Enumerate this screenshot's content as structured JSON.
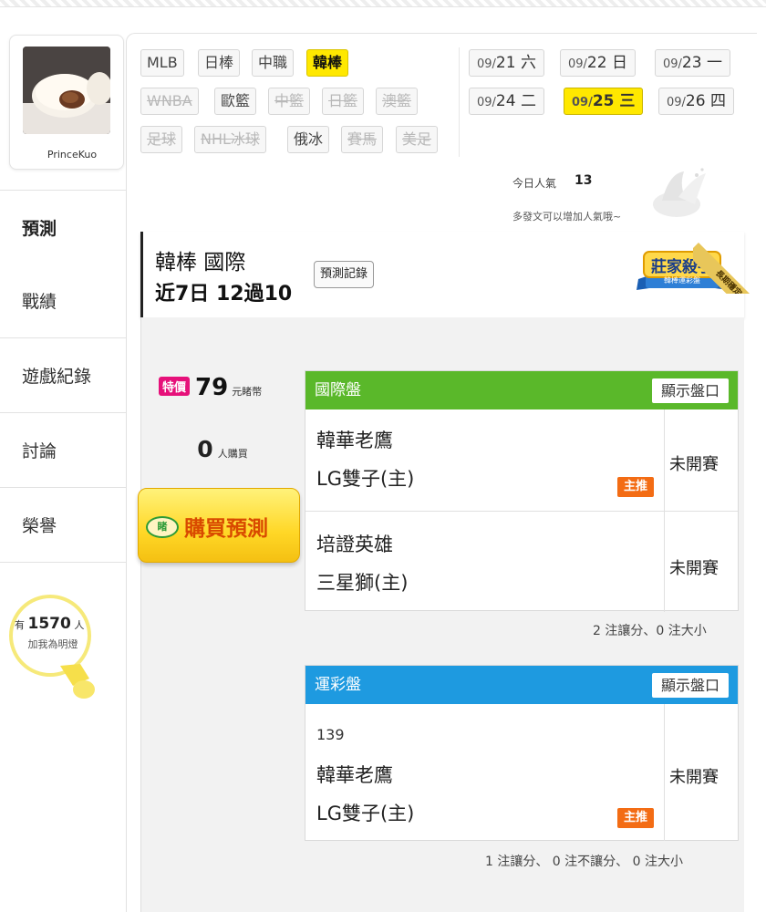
{
  "user": {
    "name": "PrinceKuo"
  },
  "sidebar": {
    "active": "預測",
    "items": [
      {
        "label": "戰績"
      },
      {
        "label": "遊戲紀錄"
      },
      {
        "label": "討論"
      },
      {
        "label": "榮譽"
      }
    ],
    "fans": {
      "prefix": "有",
      "count": "1570",
      "suffix": "人",
      "line2": "加我為明燈"
    }
  },
  "sports": [
    {
      "label": "MLB",
      "state": "normal"
    },
    {
      "label": "日棒",
      "state": "normal"
    },
    {
      "label": "中職",
      "state": "normal"
    },
    {
      "label": "韓棒",
      "state": "active"
    },
    {
      "label": "WNBA",
      "state": "disabled"
    },
    {
      "label": "歐籃",
      "state": "normal"
    },
    {
      "label": "中籃",
      "state": "disabled"
    },
    {
      "label": "日籃",
      "state": "disabled"
    },
    {
      "label": "澳籃",
      "state": "disabled"
    },
    {
      "label": "足球",
      "state": "disabled"
    },
    {
      "label": "NHL冰球",
      "state": "disabled"
    },
    {
      "label": "俄冰",
      "state": "normal"
    },
    {
      "label": "賽馬",
      "state": "disabled"
    },
    {
      "label": "美足",
      "state": "disabled"
    }
  ],
  "dates": [
    {
      "month": "09/",
      "day": "21 六",
      "active": false
    },
    {
      "month": "09/",
      "day": "22 日",
      "active": false
    },
    {
      "month": "09/",
      "day": "23 一",
      "active": false
    },
    {
      "month": "09/",
      "day": "24 二",
      "active": false
    },
    {
      "month": "09/",
      "day": "25 三",
      "active": true
    },
    {
      "month": "09/",
      "day": "26 四",
      "active": false
    }
  ],
  "popularity": {
    "label": "今日人氣",
    "count": "13",
    "hint": "多發文可以增加人氣哦~"
  },
  "header": {
    "line1": "韓棒 國際",
    "line2": "近7日 12過10",
    "record_button": "預測記錄",
    "badge_title": "莊家殺手",
    "badge_sub": "韓棒運彩盤",
    "ribbon": "長期穩定"
  },
  "purchase": {
    "special_label": "特價",
    "price": "79",
    "price_unit": "元睹幣",
    "buyers": "0",
    "buyers_unit": "人購買",
    "coin_label": "睹",
    "button_label": "購買預測"
  },
  "intl_panel": {
    "title": "國際盤",
    "show_button": "顯示盤口",
    "color": "#5ab82a",
    "games": [
      {
        "away": "韓華老鷹",
        "home": "LG雙子(主)",
        "status": "未開賽",
        "pick": "主推"
      },
      {
        "away": "培證英雄",
        "home": "三星獅(主)",
        "status": "未開賽",
        "pick": ""
      }
    ],
    "summary": "2 注讓分、0 注大小"
  },
  "lottery_panel": {
    "title": "運彩盤",
    "show_button": "顯示盤口",
    "color": "#1e9ae0",
    "games": [
      {
        "number": "139",
        "away": "韓華老鷹",
        "home": "LG雙子(主)",
        "status": "未開賽",
        "pick": "主推"
      }
    ],
    "summary": "1 注讓分、 0 注不讓分、 0 注大小"
  }
}
